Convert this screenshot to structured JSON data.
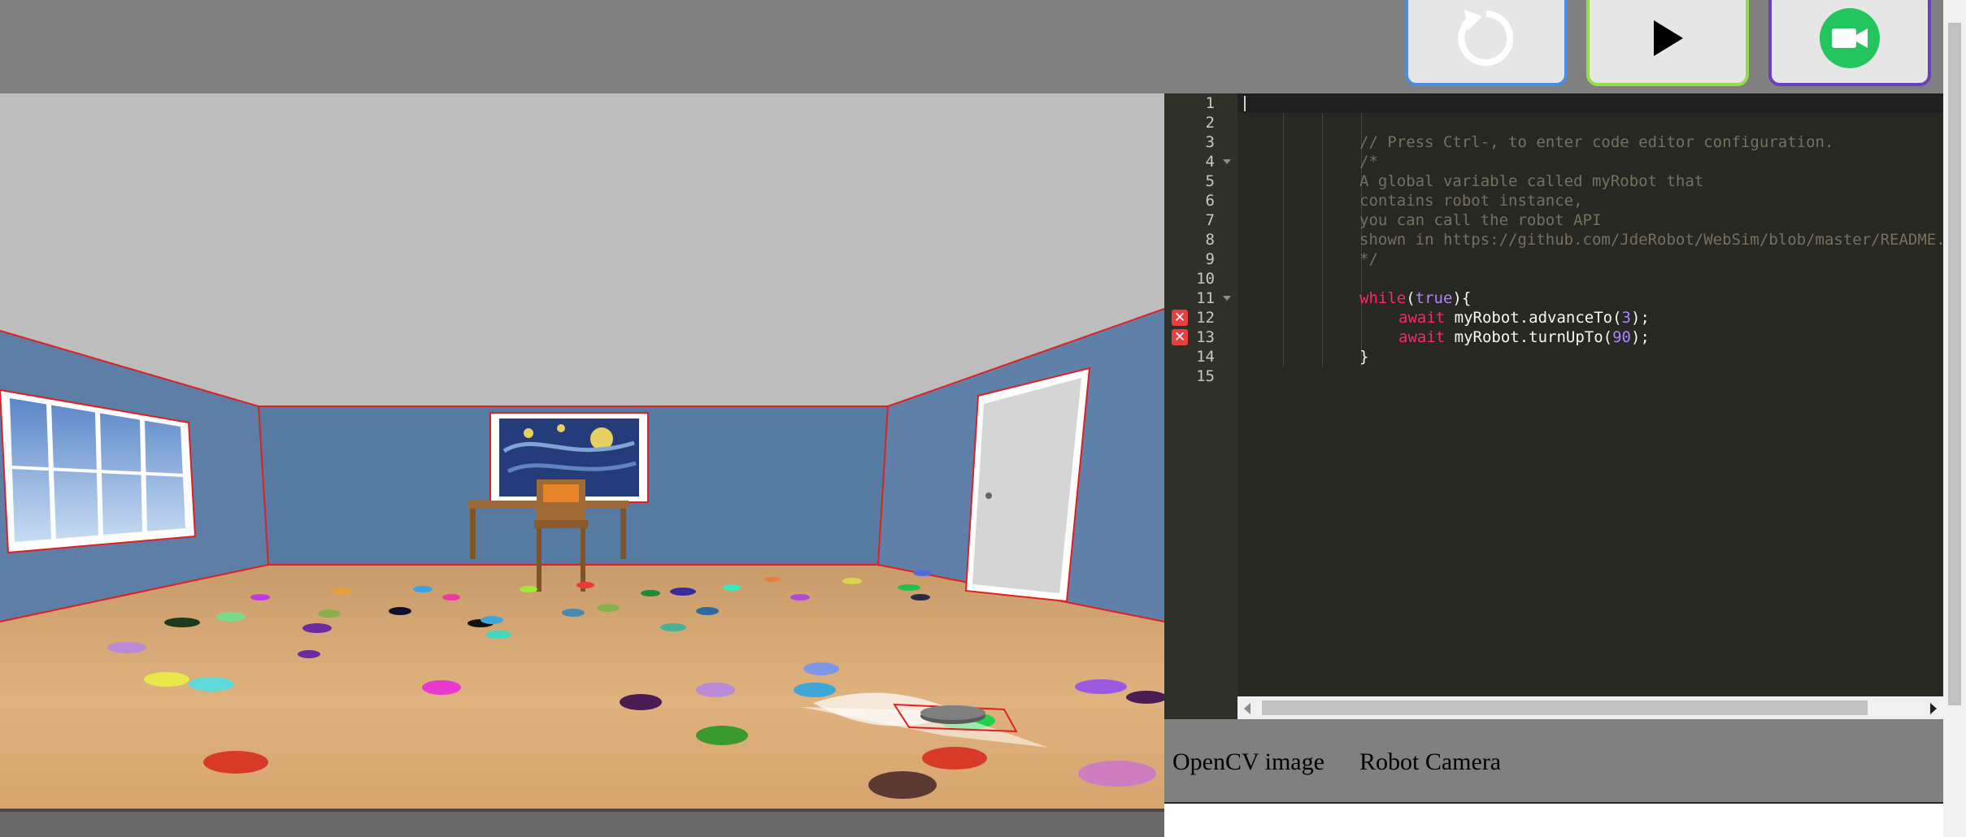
{
  "toolbar": {
    "buttons": [
      {
        "name": "reset",
        "icon": "reset-icon",
        "border_color": "#4f8de0"
      },
      {
        "name": "play",
        "icon": "play-icon",
        "border_color": "#92e042"
      },
      {
        "name": "record",
        "icon": "video-camera-icon",
        "border_color": "#6a3fc4"
      }
    ]
  },
  "editor": {
    "line_numbers": [
      "1",
      "2",
      "3",
      "4",
      "5",
      "6",
      "7",
      "8",
      "9",
      "10",
      "11",
      "12",
      "13",
      "14",
      "15"
    ],
    "folded_lines": [
      "4",
      "11"
    ],
    "error_lines": [
      "12",
      "13"
    ],
    "lines": {
      "l3": "// Press Ctrl-, to enter code editor configuration.",
      "l4": "/*",
      "l5": "A global variable called myRobot that",
      "l6": "contains robot instance,",
      "l7": "you can call the robot API",
      "l8": "shown in https://github.com/JdeRobot/WebSim/blob/master/README.md",
      "l9": "*/",
      "l11_kw": "while",
      "l11_open": "(",
      "l11_val": "true",
      "l11_close": "){",
      "l12_kw": "await",
      "l12_rest": " myRobot.advanceTo(",
      "l12_num": "3",
      "l12_end": ");",
      "l13_kw": "await",
      "l13_rest": " myRobot.turnUpTo(",
      "l13_num": "90",
      "l13_end": ");",
      "l14": "}"
    },
    "colors": {
      "background": "#272822",
      "comment": "#75715e",
      "keyword": "#f92672",
      "number": "#ae81ff",
      "text": "#f8f8f2"
    }
  },
  "bottom_links": {
    "opencv": "OpenCV image",
    "camera": "Robot Camera"
  },
  "scene": {
    "description_icons": [
      "window",
      "starry-night-painting",
      "desk",
      "chair",
      "door",
      "robot-vacuum",
      "floor-disks"
    ]
  }
}
